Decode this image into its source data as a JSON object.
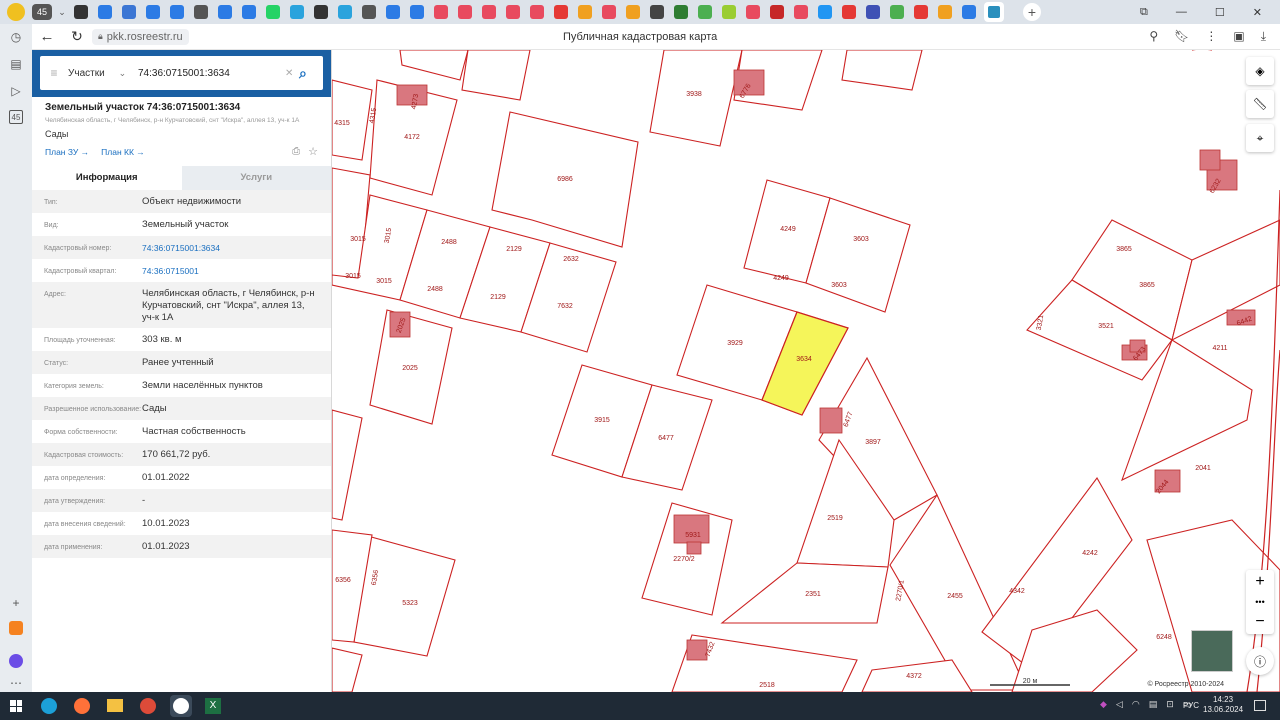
{
  "browser": {
    "tab_count_badge": "45",
    "rail_badge": "45",
    "url": "pkk.rosreestr.ru",
    "page_title": "Публичная кадастровая карта",
    "tabs": [
      {
        "name": "tab-1",
        "color": "#333"
      },
      {
        "name": "tab-2",
        "color": "#2c7be5"
      },
      {
        "name": "tab-3",
        "color": "#3b76d4"
      },
      {
        "name": "tab-4",
        "color": "#2c7be5"
      },
      {
        "name": "tab-5",
        "color": "#2c7be5"
      },
      {
        "name": "tab-6",
        "color": "#555"
      },
      {
        "name": "tab-7",
        "color": "#2c7be5"
      },
      {
        "name": "tab-8",
        "color": "#2c7be5"
      },
      {
        "name": "tab-9",
        "color": "#25d366"
      },
      {
        "name": "tab-10",
        "color": "#2aa3dd"
      },
      {
        "name": "tab-11",
        "color": "#333"
      },
      {
        "name": "tab-12",
        "color": "#2aa3dd"
      },
      {
        "name": "tab-13",
        "color": "#555"
      },
      {
        "name": "tab-14",
        "color": "#2c7be5"
      },
      {
        "name": "tab-15",
        "color": "#2c7be5"
      },
      {
        "name": "tab-16",
        "color": "#e84a5f"
      },
      {
        "name": "tab-17",
        "color": "#e84a5f"
      },
      {
        "name": "tab-18",
        "color": "#e84a5f"
      },
      {
        "name": "tab-19",
        "color": "#e84a5f"
      },
      {
        "name": "tab-20",
        "color": "#e84a5f"
      },
      {
        "name": "tab-21",
        "color": "#e53935"
      },
      {
        "name": "tab-22",
        "color": "#f0a020"
      },
      {
        "name": "tab-23",
        "color": "#e84a5f"
      },
      {
        "name": "tab-24",
        "color": "#f0a020"
      },
      {
        "name": "tab-25",
        "color": "#444"
      },
      {
        "name": "tab-26",
        "color": "#2e7d32"
      },
      {
        "name": "tab-27",
        "color": "#4caf50"
      },
      {
        "name": "tab-28",
        "color": "#9acd32"
      },
      {
        "name": "tab-29",
        "color": "#e84a5f"
      },
      {
        "name": "tab-30",
        "color": "#c62828"
      },
      {
        "name": "tab-31",
        "color": "#e84a5f"
      },
      {
        "name": "tab-32",
        "color": "#2196f3"
      },
      {
        "name": "tab-33",
        "color": "#e53935"
      },
      {
        "name": "tab-34",
        "color": "#3f51b5"
      },
      {
        "name": "tab-35",
        "color": "#4caf50"
      },
      {
        "name": "tab-36",
        "color": "#e53935"
      },
      {
        "name": "tab-37",
        "color": "#f0a020"
      },
      {
        "name": "tab-38",
        "color": "#2c7be5"
      }
    ]
  },
  "search": {
    "menu_icon": "hamburger-icon",
    "category": "Участки",
    "query": "74:36:0715001:3634"
  },
  "parcel": {
    "title": "Земельный участок 74:36:0715001:3634",
    "address_small": "Челябинская область, г Челябинск, р-н Курчатовский, снт \"Искра\", аллея 13, уч-к 1А",
    "use": "Сады",
    "plan_zu": "План ЗУ →",
    "plan_kk": "План КК →"
  },
  "tabs": {
    "info": "Информация",
    "services": "Услуги"
  },
  "info_rows": [
    {
      "label": "Тип:",
      "value": "Объект недвижимости",
      "link": false
    },
    {
      "label": "Вид:",
      "value": "Земельный участок",
      "link": false
    },
    {
      "label": "Кадастровый номер:",
      "value": "74:36:0715001:3634",
      "link": true
    },
    {
      "label": "Кадастровый квартал:",
      "value": "74:36:0715001",
      "link": true
    },
    {
      "label": "Адрес:",
      "value": "Челябинская область, г Челябинск, р-н Курчатовский, снт \"Искра\", аллея 13, уч-к 1А",
      "link": false
    },
    {
      "label": "Площадь уточненная:",
      "value": "303 кв. м",
      "link": false
    },
    {
      "label": "Статус:",
      "value": "Ранее учтенный",
      "link": false
    },
    {
      "label": "Категория земель:",
      "value": "Земли населённых пунктов",
      "link": false
    },
    {
      "label": "Разрешенное использование:",
      "value": "Сады",
      "link": false
    },
    {
      "label": "Форма собственности:",
      "value": "Частная собственность",
      "link": false
    },
    {
      "label": "Кадастровая стоимость:",
      "value": "170 661,72 руб.",
      "link": false
    },
    {
      "label": "дата определения:",
      "value": "01.01.2022",
      "link": false
    },
    {
      "label": "дата утверждения:",
      "value": "-",
      "link": false
    },
    {
      "label": "дата внесения сведений:",
      "value": "10.01.2023",
      "link": false
    },
    {
      "label": "дата применения:",
      "value": "01.01.2023",
      "link": false
    }
  ],
  "map": {
    "parcel_labels": [
      {
        "t": "4315"
      },
      {
        "t": "4315"
      },
      {
        "t": "4172"
      },
      {
        "t": "4273"
      },
      {
        "t": "3938"
      },
      {
        "t": "6776"
      },
      {
        "t": "6986"
      },
      {
        "t": "3015"
      },
      {
        "t": "3015"
      },
      {
        "t": "3015"
      },
      {
        "t": "3015"
      },
      {
        "t": "2488"
      },
      {
        "t": "2488"
      },
      {
        "t": "2129"
      },
      {
        "t": "2129"
      },
      {
        "t": "2632"
      },
      {
        "t": "7632"
      },
      {
        "t": "4249"
      },
      {
        "t": "4249"
      },
      {
        "t": "3603"
      },
      {
        "t": "3603"
      },
      {
        "t": "3929"
      },
      {
        "t": "3634"
      },
      {
        "t": "2025"
      },
      {
        "t": "2025"
      },
      {
        "t": "3915"
      },
      {
        "t": "6477"
      },
      {
        "t": "6477"
      },
      {
        "t": "3897"
      },
      {
        "t": "2519"
      },
      {
        "t": "5931"
      },
      {
        "t": "2270/2"
      },
      {
        "t": "2351"
      },
      {
        "t": "2270/1"
      },
      {
        "t": "2455"
      },
      {
        "t": "4342"
      },
      {
        "t": "4242"
      },
      {
        "t": "6248"
      },
      {
        "t": "6356"
      },
      {
        "t": "6356"
      },
      {
        "t": "5323"
      },
      {
        "t": "2518"
      },
      {
        "t": "4372"
      },
      {
        "t": "7432"
      },
      {
        "t": "3865"
      },
      {
        "t": "3865"
      },
      {
        "t": "3521"
      },
      {
        "t": "3321"
      },
      {
        "t": "6473"
      },
      {
        "t": "4211"
      },
      {
        "t": "6442"
      },
      {
        "t": "2041"
      },
      {
        "t": "2044"
      },
      {
        "t": "6232"
      }
    ],
    "scale_label": "20 м",
    "copyright": "© Росреестр 2010-2024"
  },
  "taskbar": {
    "lang": "РУС",
    "time": "14:23",
    "date": "13.06.2024"
  },
  "colors": {
    "parcel_line": "#cc2222",
    "parcel_fill": "#ffffff",
    "building": "#d9777f",
    "selected": "#f5f55a",
    "search_bg": "#1a5fa3",
    "link": "#1a6fc0"
  }
}
